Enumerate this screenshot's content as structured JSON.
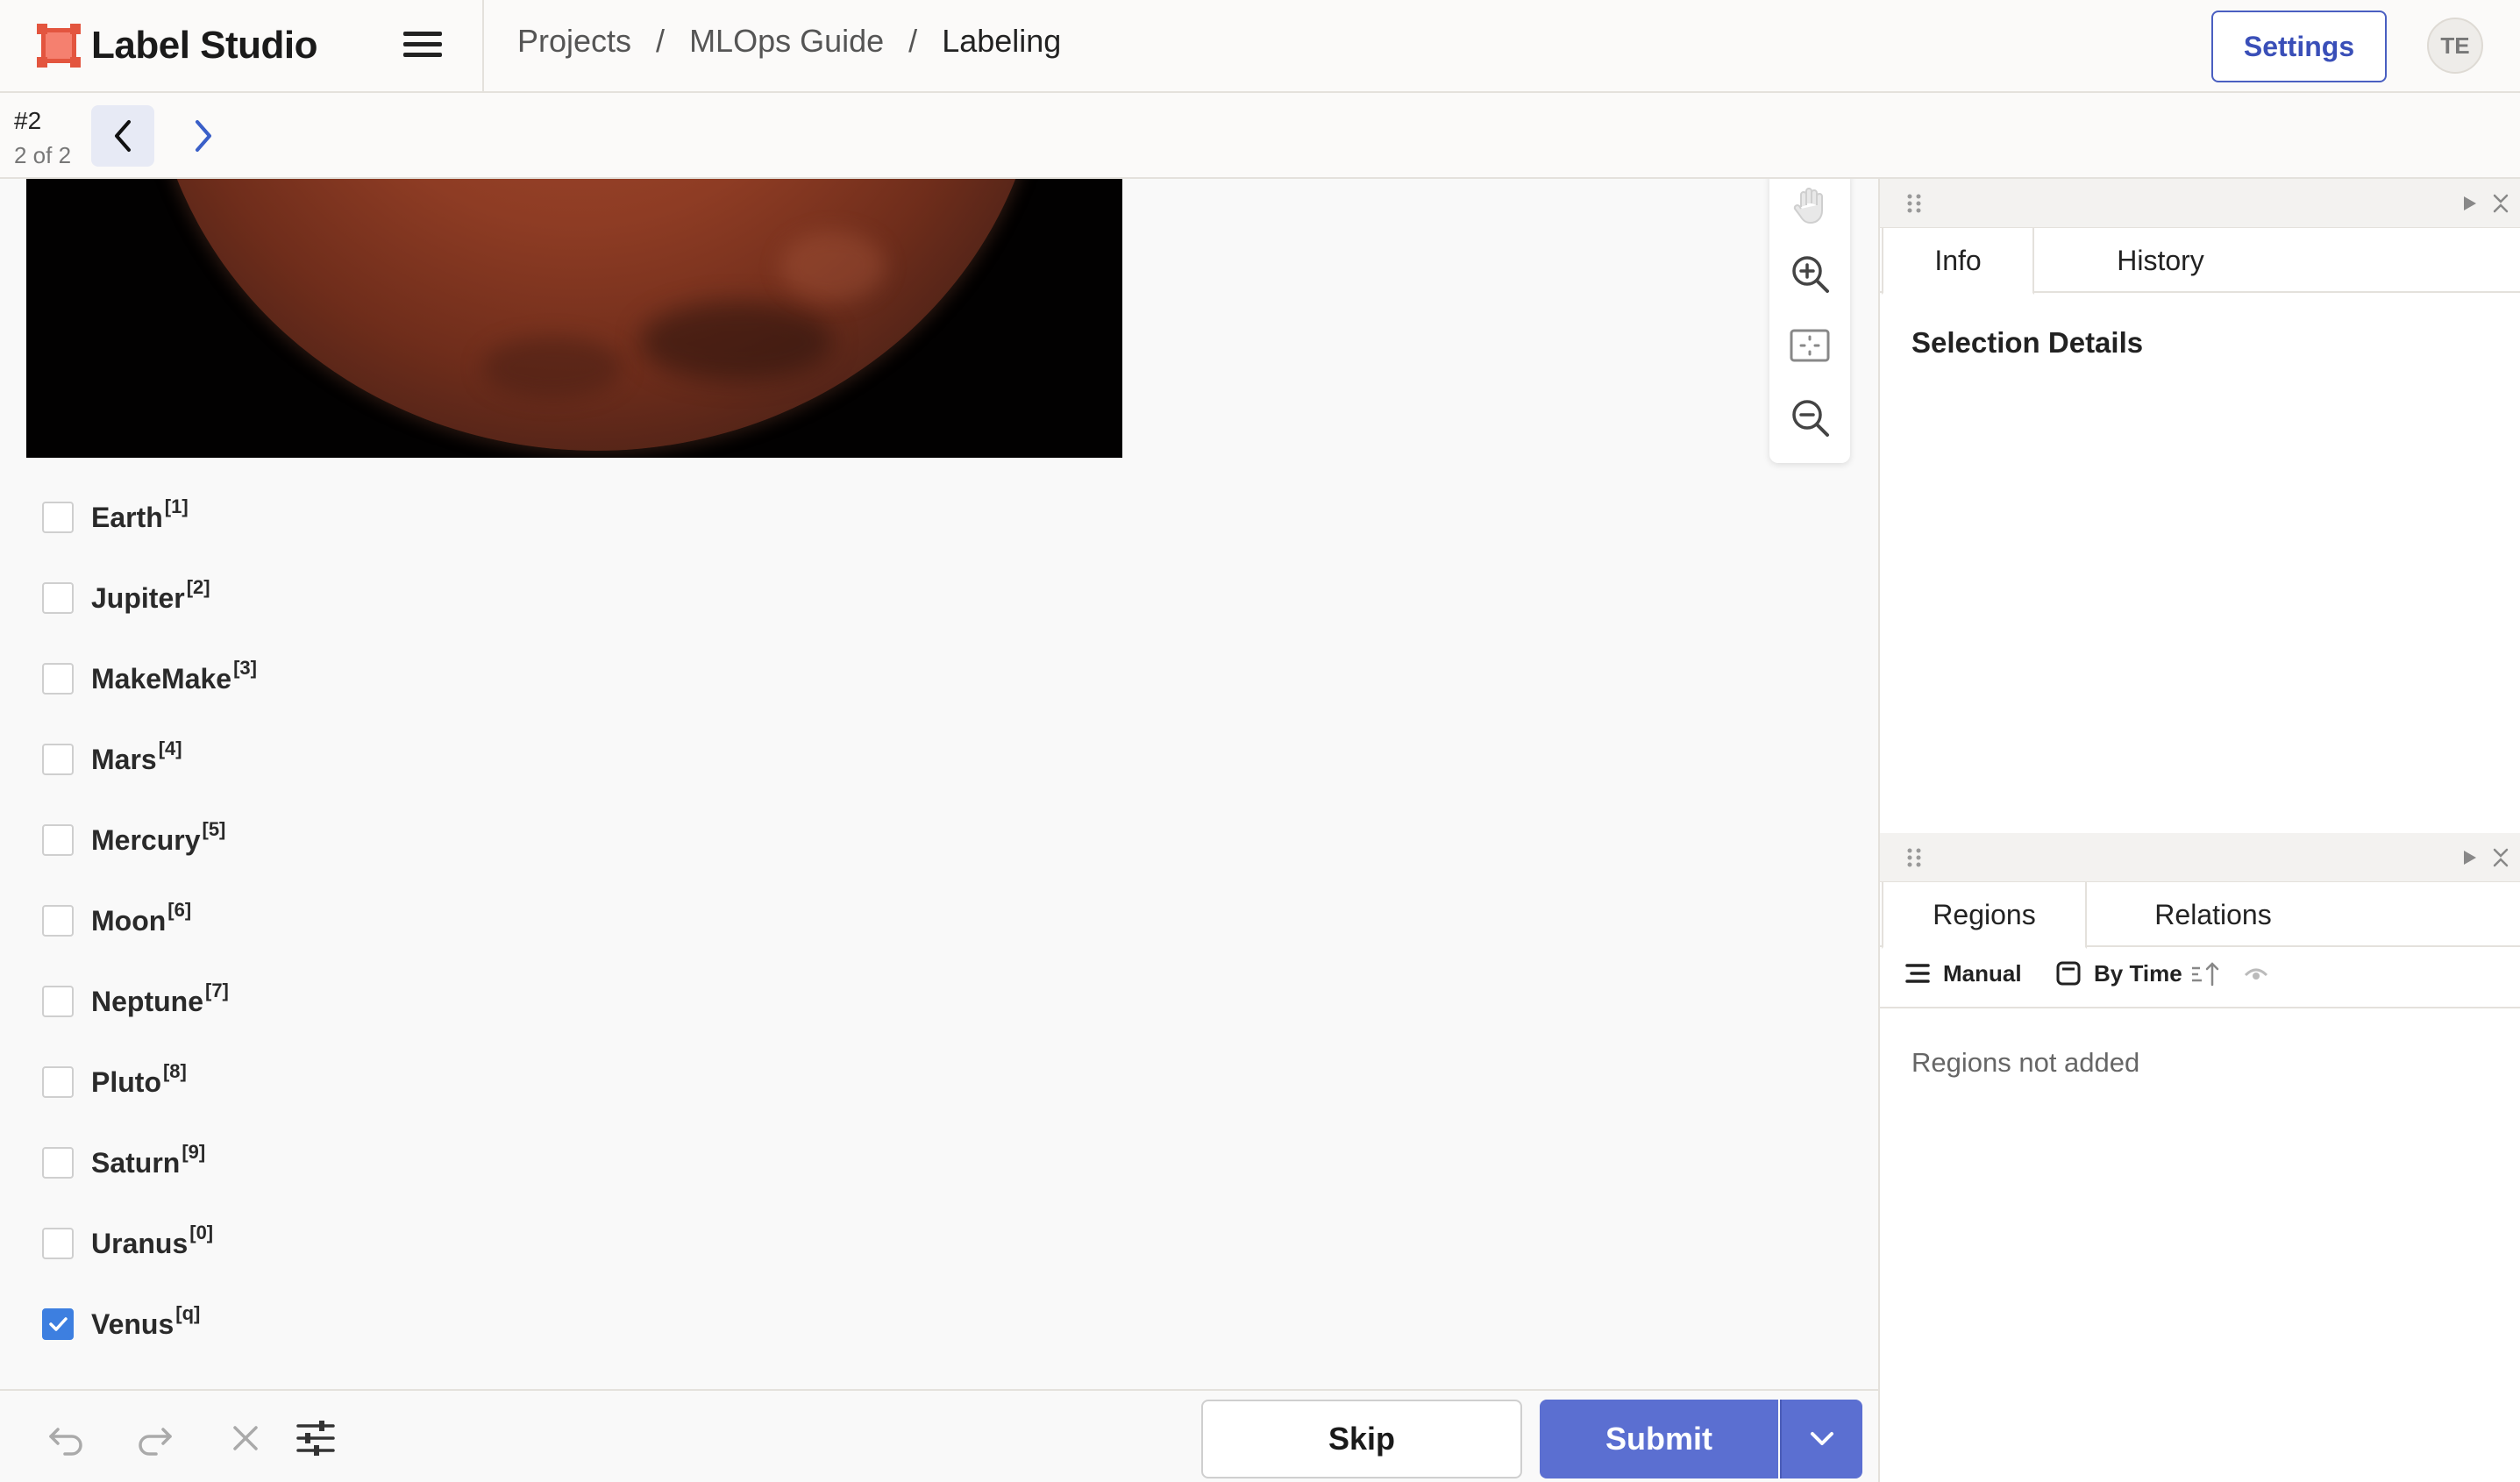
{
  "header": {
    "app_name": "Label Studio",
    "breadcrumb": {
      "projects": "Projects",
      "project": "MLOps Guide",
      "current": "Labeling",
      "separator": "/"
    },
    "settings_label": "Settings",
    "avatar_initials": "TE"
  },
  "task": {
    "id_label": "#2",
    "position_label": "2 of 2"
  },
  "choices": [
    {
      "label": "Earth",
      "hotkey": "[1]",
      "checked": false
    },
    {
      "label": "Jupiter",
      "hotkey": "[2]",
      "checked": false
    },
    {
      "label": "MakeMake",
      "hotkey": "[3]",
      "checked": false
    },
    {
      "label": "Mars",
      "hotkey": "[4]",
      "checked": false
    },
    {
      "label": "Mercury",
      "hotkey": "[5]",
      "checked": false
    },
    {
      "label": "Moon",
      "hotkey": "[6]",
      "checked": false
    },
    {
      "label": "Neptune",
      "hotkey": "[7]",
      "checked": false
    },
    {
      "label": "Pluto",
      "hotkey": "[8]",
      "checked": false
    },
    {
      "label": "Saturn",
      "hotkey": "[9]",
      "checked": false
    },
    {
      "label": "Uranus",
      "hotkey": "[0]",
      "checked": false
    },
    {
      "label": "Venus",
      "hotkey": "[q]",
      "checked": true
    }
  ],
  "actions": {
    "skip_label": "Skip",
    "submit_label": "Submit"
  },
  "info_panel": {
    "tabs": [
      "Info",
      "History"
    ],
    "active_tab": "Info",
    "title": "Selection Details"
  },
  "regions_panel": {
    "tabs": [
      "Regions",
      "Relations"
    ],
    "active_tab": "Regions",
    "group_label": "Manual",
    "sort_label": "By Time",
    "empty_text": "Regions not added"
  },
  "colors": {
    "accent": "#5b6fd1",
    "checkbox_checked": "#3d7fe0",
    "logo": "#e3553f"
  },
  "icons": {
    "toolbar": [
      "undo-icon",
      "redo-icon",
      "reset-icon",
      "settings-sliders-icon"
    ],
    "zoom": [
      "hand-pan-icon",
      "zoom-in-icon",
      "fit-screen-icon",
      "zoom-out-icon"
    ]
  }
}
